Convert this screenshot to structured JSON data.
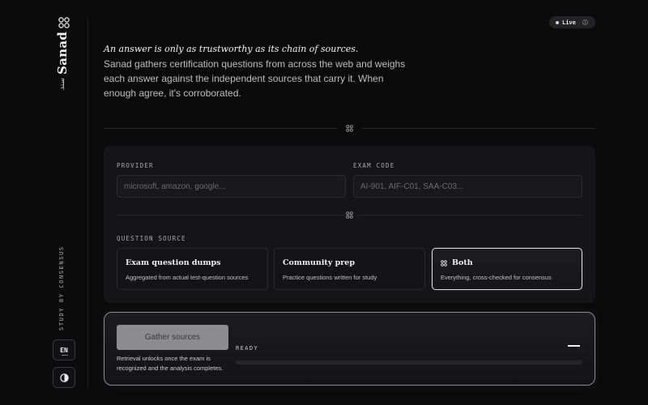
{
  "sidebar": {
    "brand": "Sanad",
    "brand_arabic": "سند",
    "tagline": "STUDY BY CONSENSUS",
    "language": "EN",
    "theme_icon": "contrast-icon"
  },
  "header": {
    "status_label": "Live"
  },
  "intro": {
    "lead": "An answer is only as trustworthy as its chain of sources.",
    "body": "Sanad gathers certification questions from across the web and weighs each answer against the independent sources that carry it. When enough agree, it's corroborated."
  },
  "form": {
    "provider_label": "PROVIDER",
    "provider_placeholder": "microsoft, amazon, google...",
    "provider_value": "",
    "exam_label": "EXAM CODE",
    "exam_placeholder": "AI-901, AIF-C01, SAA-C03...",
    "exam_value": "",
    "source_label": "QUESTION SOURCE",
    "sources": [
      {
        "title": "Exam question dumps",
        "desc": "Aggregated from actual test-question sources",
        "selected": false
      },
      {
        "title": "Community prep",
        "desc": "Practice questions written for study",
        "selected": false
      },
      {
        "title": "Both",
        "desc": "Everything, cross-checked for consensus",
        "selected": true
      }
    ]
  },
  "action": {
    "gather_label": "Gather sources",
    "hint": "Retrieval unlocks once the exam is recognized and the analysis completes.",
    "status": "READY",
    "progress": 0
  },
  "colors": {
    "background": "#0b0b0c",
    "card": "#151517",
    "accent": "#e5e5e8",
    "button_disabled": "#8c8c8f"
  }
}
